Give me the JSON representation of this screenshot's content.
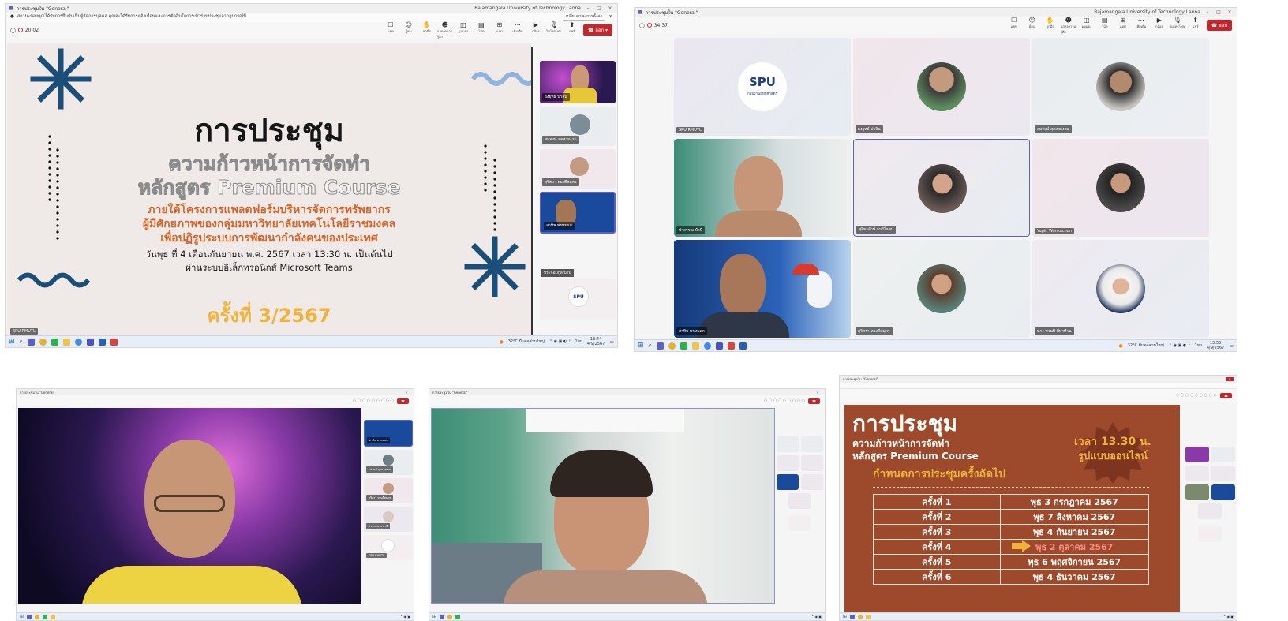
{
  "shot1": {
    "window_title": "การประชุมใน \"General\"",
    "org": "Rajamangala University of Technology Lanna",
    "notice": "สถานะของคุณได้รับการยืนยันเป็นผู้จัดการบุคคล คุณจะได้รับการแจ้งเตือนและการตัดสินใจการเข้าร่วมประชุมจากอุปกรณ์นี้",
    "notice_button": "เปลี่ยนแปลงการตั้งค่า",
    "timer": "20:02",
    "toolbar": [
      {
        "icon": "chat-icon",
        "label": "แชท"
      },
      {
        "icon": "people-icon",
        "label": "ผู้คน"
      },
      {
        "icon": "hand-icon",
        "label": "ยกมือ"
      },
      {
        "icon": "react-icon",
        "label": "แสดงความรู้สึก"
      },
      {
        "icon": "view-icon",
        "label": "มุมมอง"
      },
      {
        "icon": "notes-icon",
        "label": "โน้ต"
      },
      {
        "icon": "apps-icon",
        "label": "แอป"
      },
      {
        "icon": "more-icon",
        "label": "เพิ่มเติม"
      },
      {
        "icon": "camera-icon",
        "label": "กล้อง"
      },
      {
        "icon": "mic-icon",
        "label": "ไมโครโฟน"
      },
      {
        "icon": "share-icon",
        "label": "แชร์"
      }
    ],
    "leave": "ออก",
    "slide": {
      "title": "การประชุม",
      "subtitle_1": "ความก้าวหน้าการจัดทำ",
      "subtitle_2": "หลักสูตร Premium Course",
      "line_1": "ภายใต้โครงการแพลตฟอร์มบริหารจัดการทรัพยากร",
      "line_2": "ผู้มีศักยภาพของกลุ่มมหาวิทยาลัยเทคโนโลยีราชมงคล",
      "line_3": "เพื่อปฏิรูประบบการพัฒนากำลังคนของประเทศ",
      "date_line": "วันพุธ ที่ 4 เดือนกันยายน พ.ศ. 2567 เวลา 13:30 น. เป็นต้นไป",
      "via_line": "ผ่านระบบอิเล็กทรอนิกส์ Microsoft Teams",
      "session": "ครั้งที่ 3/2567"
    },
    "presenter": "SPU RMUTL",
    "gallery": [
      "ยงยุทธ์ ปาลิน",
      "สมพงษ์ สุดสวยงาม",
      "สุจิตรา ทองดีสมุทร",
      "สาทิพ พรหมแก",
      "ประกอบกุล ปำนี"
    ],
    "taskbar_weather": "32°C มีแดดส่วนใหญ่",
    "taskbar_lang": "ไทย",
    "taskbar_time": "13:44",
    "taskbar_date": "4/9/2567"
  },
  "shot2": {
    "window_title": "การประชุมใน \"General\"",
    "org": "Rajamangala University of Technology Lanna",
    "timer": "34:37",
    "leave": "ออก",
    "logo_text": "SPU",
    "logo_sub": "กลุ่มงานยุทธศาสตร์",
    "tiles": [
      "SPU RMUTL",
      "ยงยุทธ์ ปาลิน",
      "สมพงษ์ สุดสวยงาม",
      "ปาลรรณ ปำนี",
      "สุจิตรลักษ์ ธนวิไลสม",
      "Yupin Wonkuchon",
      "สาทิพ พรหมแก",
      "สุจิตรา ทองดีสมุทร",
      "นาง ชวนปี ทีทำทำน"
    ],
    "taskbar_weather": "32°C มีแดดส่วนใหญ่",
    "taskbar_lang": "ไทย",
    "taskbar_time": "13:55",
    "taskbar_date": "4/9/2567"
  },
  "shot3": {
    "window_title": "การประชุมใน \"General\"",
    "gallery": [
      "สาทิพ พรหมแก",
      "สมพงษ์ สุดสวยงาม",
      "สุจิตรา ทองดีสมุทร",
      "ประกอบกุล ปำนี",
      "SPU RMUTL"
    ]
  },
  "shot4": {
    "window_title": "การประชุมใน \"General\""
  },
  "shot5": {
    "window_title": "การประชุมใน \"General\"",
    "title": "การประชุม",
    "subtitle_1": "ความก้าวหน้าการจัดทำ",
    "subtitle_2": "หลักสูตร Premium Course",
    "badge_1": "เวลา 13.30 น.",
    "badge_2": "รูปแบบออนไลน์",
    "schedule_heading": "กำหนดการประชุมครั้งถัดไป",
    "rows": [
      {
        "n": "ครั้งที่ 1",
        "date": "พุธ 3 กรกฎาคม 2567"
      },
      {
        "n": "ครั้งที่ 2",
        "date": "พุธ 7 สิงหาคม 2567"
      },
      {
        "n": "ครั้งที่ 3",
        "date": "พุธ 4 กันยายน 2567"
      },
      {
        "n": "ครั้งที่ 4",
        "date": "พุธ 2 ตุลาคม 2567"
      },
      {
        "n": "ครั้งที่ 5",
        "date": "พุธ 6 พฤศจิกายน 2567"
      },
      {
        "n": "ครั้งที่ 6",
        "date": "พุธ 4 ธันวาคม 2567"
      }
    ]
  },
  "colors": {
    "slide_bg": "#efeae8",
    "navy": "#1b4f7a",
    "orange_text": "#d2672b",
    "gold": "#f0b23a",
    "brown": "#9c4a2b",
    "teams_red": "#c4262e",
    "highlight": "#ff8a8a"
  }
}
